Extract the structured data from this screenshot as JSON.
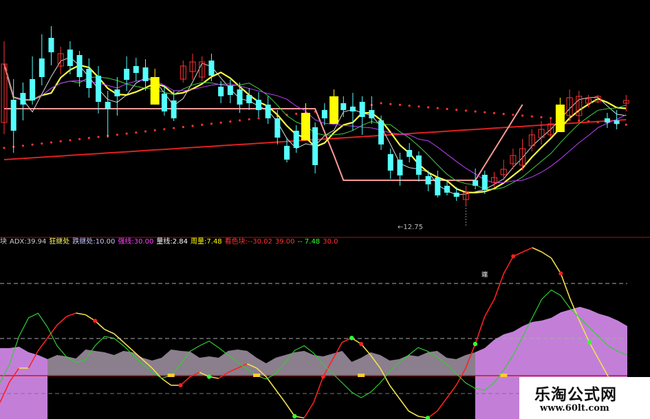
{
  "indicator_legend": [
    {
      "text": "块",
      "color": "#cccccc"
    },
    {
      "text": "ADX:39.94",
      "color": "#cccccc"
    },
    {
      "text": "狂继处",
      "color": "#ffff66"
    },
    {
      "text": "跌继处:10.00",
      "color": "#c8c8ff"
    },
    {
      "text": "强线:30.00",
      "color": "#ff44ff"
    },
    {
      "text": "量线:2.84",
      "color": "#ffffff"
    },
    {
      "text": "周量:7.48",
      "color": "#ffff00"
    },
    {
      "text": "看色块:--30.02",
      "color": "#ff3333"
    },
    {
      "text": "39.00",
      "color": "#ff3333"
    },
    {
      "text": "-- 7.48",
      "color": "#33ff33"
    },
    {
      "text": "30.0",
      "color": "#ff3333"
    }
  ],
  "low_marker": "←12.75",
  "annotation": "端",
  "watermark": {
    "title": "乐淘公式网",
    "url": "www.60lt.com"
  },
  "colors": {
    "up": "#ff3333",
    "down": "#54ffff",
    "highlight_box": "#ffff00",
    "ma_white": "#dddddd",
    "ma_yellow": "#ffff44",
    "ma_purple": "#c040ff",
    "ma_green": "#44cc44",
    "ma_red": "#e02020",
    "band_pink": "#ff9a9a",
    "histogram": "#c37fd8",
    "histogram_grey": "#9a8c9c"
  },
  "chart_data": [
    {
      "type": "candlestick",
      "candles": [
        {
          "o": 178,
          "c": 93,
          "h": 60,
          "l": 195
        },
        {
          "o": 145,
          "c": 190,
          "h": 115,
          "l": 222
        },
        {
          "o": 135,
          "c": 152,
          "h": 120,
          "l": 175
        },
        {
          "o": 115,
          "c": 146,
          "h": 82,
          "l": 152
        },
        {
          "o": 85,
          "c": 112,
          "h": 50,
          "l": 124
        },
        {
          "o": 55,
          "c": 76,
          "h": 38,
          "l": 95
        },
        {
          "o": 96,
          "c": 78,
          "h": 68,
          "l": 108
        },
        {
          "o": 72,
          "c": 96,
          "h": 60,
          "l": 108
        },
        {
          "o": 80,
          "c": 112,
          "h": 74,
          "l": 126
        },
        {
          "o": 100,
          "c": 128,
          "h": 85,
          "l": 142
        },
        {
          "o": 110,
          "c": 148,
          "h": 96,
          "l": 165
        },
        {
          "o": 148,
          "c": 158,
          "h": 132,
          "l": 200
        },
        {
          "o": 130,
          "c": 140,
          "h": 112,
          "l": 168
        },
        {
          "o": 100,
          "c": 116,
          "h": 82,
          "l": 132
        },
        {
          "o": 96,
          "c": 106,
          "h": 84,
          "l": 118
        },
        {
          "o": 98,
          "c": 118,
          "h": 86,
          "l": 132
        },
        {
          "o": 112,
          "c": 126,
          "h": 100,
          "l": 140
        },
        {
          "o": 136,
          "c": 162,
          "h": 124,
          "l": 168
        },
        {
          "o": 146,
          "c": 172,
          "h": 132,
          "l": 176
        },
        {
          "o": 115,
          "c": 96,
          "h": 88,
          "l": 120
        },
        {
          "o": 104,
          "c": 90,
          "h": 78,
          "l": 116
        },
        {
          "o": 112,
          "c": 90,
          "h": 82,
          "l": 118
        },
        {
          "o": 88,
          "c": 110,
          "h": 78,
          "l": 118
        },
        {
          "o": 126,
          "c": 140,
          "h": 118,
          "l": 150
        },
        {
          "o": 124,
          "c": 138,
          "h": 116,
          "l": 150
        },
        {
          "o": 130,
          "c": 152,
          "h": 120,
          "l": 164
        },
        {
          "o": 138,
          "c": 150,
          "h": 128,
          "l": 160
        },
        {
          "o": 145,
          "c": 160,
          "h": 134,
          "l": 170
        },
        {
          "o": 152,
          "c": 172,
          "h": 140,
          "l": 180
        },
        {
          "o": 172,
          "c": 200,
          "h": 160,
          "l": 210
        },
        {
          "o": 212,
          "c": 232,
          "h": 200,
          "l": 236
        },
        {
          "o": 190,
          "c": 215,
          "h": 182,
          "l": 222
        },
        {
          "o": 164,
          "c": 180,
          "h": 150,
          "l": 194
        },
        {
          "o": 185,
          "c": 240,
          "h": 178,
          "l": 252
        },
        {
          "o": 160,
          "c": 172,
          "h": 150,
          "l": 182
        },
        {
          "o": 140,
          "c": 156,
          "h": 130,
          "l": 166
        },
        {
          "o": 150,
          "c": 160,
          "h": 140,
          "l": 170
        },
        {
          "o": 155,
          "c": 162,
          "h": 135,
          "l": 190
        },
        {
          "o": 148,
          "c": 170,
          "h": 140,
          "l": 196
        },
        {
          "o": 160,
          "c": 172,
          "h": 140,
          "l": 180
        },
        {
          "o": 175,
          "c": 210,
          "h": 168,
          "l": 218
        },
        {
          "o": 224,
          "c": 248,
          "h": 216,
          "l": 260
        },
        {
          "o": 232,
          "c": 255,
          "h": 222,
          "l": 270
        },
        {
          "o": 218,
          "c": 228,
          "h": 208,
          "l": 236
        },
        {
          "o": 226,
          "c": 254,
          "h": 220,
          "l": 264
        },
        {
          "o": 256,
          "c": 268,
          "h": 248,
          "l": 278
        },
        {
          "o": 258,
          "c": 284,
          "h": 248,
          "l": 287
        },
        {
          "o": 270,
          "c": 280,
          "h": 262,
          "l": 284
        },
        {
          "o": 280,
          "c": 286,
          "h": 272,
          "l": 292
        },
        {
          "o": 290,
          "c": 280,
          "h": 270,
          "l": 298
        },
        {
          "o": 262,
          "c": 270,
          "h": 245,
          "l": 275
        },
        {
          "o": 254,
          "c": 276,
          "h": 248,
          "l": 282
        },
        {
          "o": 265,
          "c": 258,
          "h": 250,
          "l": 272
        },
        {
          "o": 254,
          "c": 246,
          "h": 232,
          "l": 262
        },
        {
          "o": 238,
          "c": 226,
          "h": 216,
          "l": 246
        },
        {
          "o": 240,
          "c": 216,
          "h": 202,
          "l": 248
        },
        {
          "o": 212,
          "c": 196,
          "h": 188,
          "l": 220
        },
        {
          "o": 200,
          "c": 188,
          "h": 176,
          "l": 210
        },
        {
          "o": 196,
          "c": 180,
          "h": 170,
          "l": 200
        },
        {
          "o": 182,
          "c": 152,
          "h": 142,
          "l": 188
        },
        {
          "o": 168,
          "c": 142,
          "h": 130,
          "l": 174
        },
        {
          "o": 168,
          "c": 140,
          "h": 132,
          "l": 178
        },
        {
          "o": 150,
          "c": 144,
          "h": 138,
          "l": 156
        },
        {
          "o": 148,
          "c": 140,
          "h": 138,
          "l": 150
        },
        {
          "o": 172,
          "c": 178,
          "h": 164,
          "l": 186
        },
        {
          "o": 175,
          "c": 180,
          "h": 160,
          "l": 188
        },
        {
          "o": 150,
          "c": 146,
          "h": 138,
          "l": 162
        }
      ],
      "highlight_candles": [
        16,
        32,
        35,
        59
      ],
      "low_marker_index": 49
    },
    {
      "type": "line+area",
      "series": [
        {
          "values": [
            180,
            156,
            140,
            140,
            120,
            105,
            90,
            80,
            76,
            78,
            85,
            95,
            100,
            110,
            120,
            130,
            140,
            152,
            160,
            160,
            150,
            145,
            150,
            152,
            145,
            140,
            135,
            140,
            150,
            165,
            180,
            196,
            198,
            180,
            150,
            130,
            110,
            105,
            112,
            125,
            140,
            160,
            175,
            190,
            196,
            198,
            190,
            175,
            160,
            140,
            112,
            80,
            60,
            30,
            10,
            5,
            0,
            5,
            12,
            30,
            60,
            86,
            110,
            130,
            150,
            162,
            168
          ]
        },
        {
          "values": [
            190,
            170,
            140,
            120,
            115,
            130,
            150,
            162,
            168,
            165,
            150,
            140,
            142,
            150,
            160,
            170,
            178,
            185,
            182,
            170,
            156,
            150,
            145,
            152,
            160,
            168,
            175,
            182,
            186,
            180,
            168,
            155,
            150,
            158,
            170,
            180,
            190,
            200,
            206,
            200,
            190,
            178,
            168,
            160,
            152,
            156,
            162,
            170,
            180,
            190,
            196,
            198,
            190,
            176,
            160,
            140,
            120,
            100,
            90,
            96,
            110,
            120,
            130,
            140,
            150,
            156,
            160
          ]
        }
      ],
      "histogram": [
        40,
        40,
        42,
        34,
        30,
        24,
        30,
        28,
        25,
        38,
        36,
        34,
        30,
        36,
        34,
        26,
        22,
        26,
        38,
        36,
        35,
        26,
        28,
        26,
        36,
        38,
        36,
        26,
        18,
        26,
        30,
        34,
        36,
        30,
        28,
        32,
        36,
        20,
        26,
        34,
        30,
        22,
        24,
        30,
        28,
        34,
        36,
        26,
        24,
        30,
        34,
        40,
        52,
        60,
        64,
        72,
        78,
        80,
        84,
        92,
        96,
        100,
        96,
        90,
        86,
        80,
        72
      ],
      "red_markers": [
        10,
        19,
        34,
        38,
        54,
        59
      ],
      "green_markers": [
        22,
        31,
        37,
        45,
        50,
        62
      ]
    }
  ]
}
